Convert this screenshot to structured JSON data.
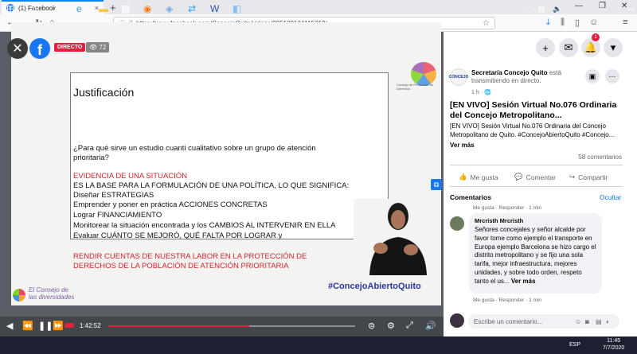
{
  "browser": {
    "tab_title": "(1) Facebook",
    "tab_close": "×",
    "new_tab": "+",
    "url": "https://www.facebook.com/ConcejoQuito/videos/205138134115313/",
    "window_minimize": "—",
    "window_maximize": "❐",
    "window_close": "✕"
  },
  "video": {
    "live_badge": "DIRECTO",
    "viewer_count": "72",
    "elapsed": "1:42:52",
    "progress_fraction": 0.57,
    "slide": {
      "title": "Justificación",
      "question_line1": "¿Para qué sirve un estudio cuanti cualitativo sobre un grupo de atención",
      "question_line2": "prioritaria?",
      "evidence_heading": "EVIDENCIA DE UNA SITUACIÓN",
      "lines": [
        "ES LA BASE PARA LA FORMULACIÓN DE UNA POLÍTICA, LO QUE SIGNIFICA:",
        "Diseñar ESTRATEGIAS",
        "Emprender y poner en práctica  ACCIONES CONCRETAS",
        "Lograr FINANCIAMIENTO",
        "Monitorear la situación encontrada y los CAMBIOS AL INTERVENIR EN ELLA",
        "Evaluar CUÁNTO SE MEJORÓ, QUÉ FALTA POR LOGRAR  y"
      ],
      "closing_line1": "RENDIR CUENTAS DE NUESTRA LABOR EN LA PROTECCIÓN DE",
      "closing_line2": "DERECHOS DE LA POBLACIÓN DE ATENCIÓN PRIORITARIA",
      "hashtag": "#ConcejoAbiertoQuito",
      "footer_brand_line1": "El Consejo de",
      "footer_brand_line2": "las diversidades",
      "logo_text": "Consejo de Protección de Derechos"
    }
  },
  "panel": {
    "notification_count": "1",
    "page_name": "Secretaría Concejo Quito",
    "page_status": "está transmitiendo en directo.",
    "avatar_text": "CONCEJO",
    "post_time": "1 h · 🌐",
    "post_title": "[EN VIVO] Sesión Virtual No.076 Ordinaria del Concejo Metropolitano...",
    "post_description": "[EN VIVO] Sesión Virtual No.076 Ordinaria del Concejo Metropolitano de Quito. #ConcejoAbiertoQuito #Concejo...",
    "see_more": "Ver más",
    "comment_count": "58 comentarios",
    "actions": {
      "like": "Me gusta",
      "comment": "Comentar",
      "share": "Compartir"
    },
    "comments_header": "Comentarios",
    "hide": "Ocultar",
    "prev_comment_meta": "Me gusta · Responder · 1 min",
    "comment": {
      "author": "Mrcristh Mrcristh",
      "text": "Señores concejales y señor alcalde por favor tome como ejemplo el transporte en Europa ejemplo Barcelona se hizo cargo el distrito metropolitano y se fijo una sola tarifa, mejor infraestructura, mejores unidades, y sobre todo orden, respeto tanto el us...",
      "see_more": "Ver más",
      "meta": "Me gusta · Responder · 1 min"
    },
    "write_placeholder": "Escribe un comentario..."
  },
  "taskbar": {
    "language": "ESP",
    "time": "11:45",
    "date": "7/7/2020"
  },
  "colors": {
    "facebook_blue": "#1877f2",
    "live_red": "#e41e3f",
    "slide_red": "#d0232a"
  }
}
